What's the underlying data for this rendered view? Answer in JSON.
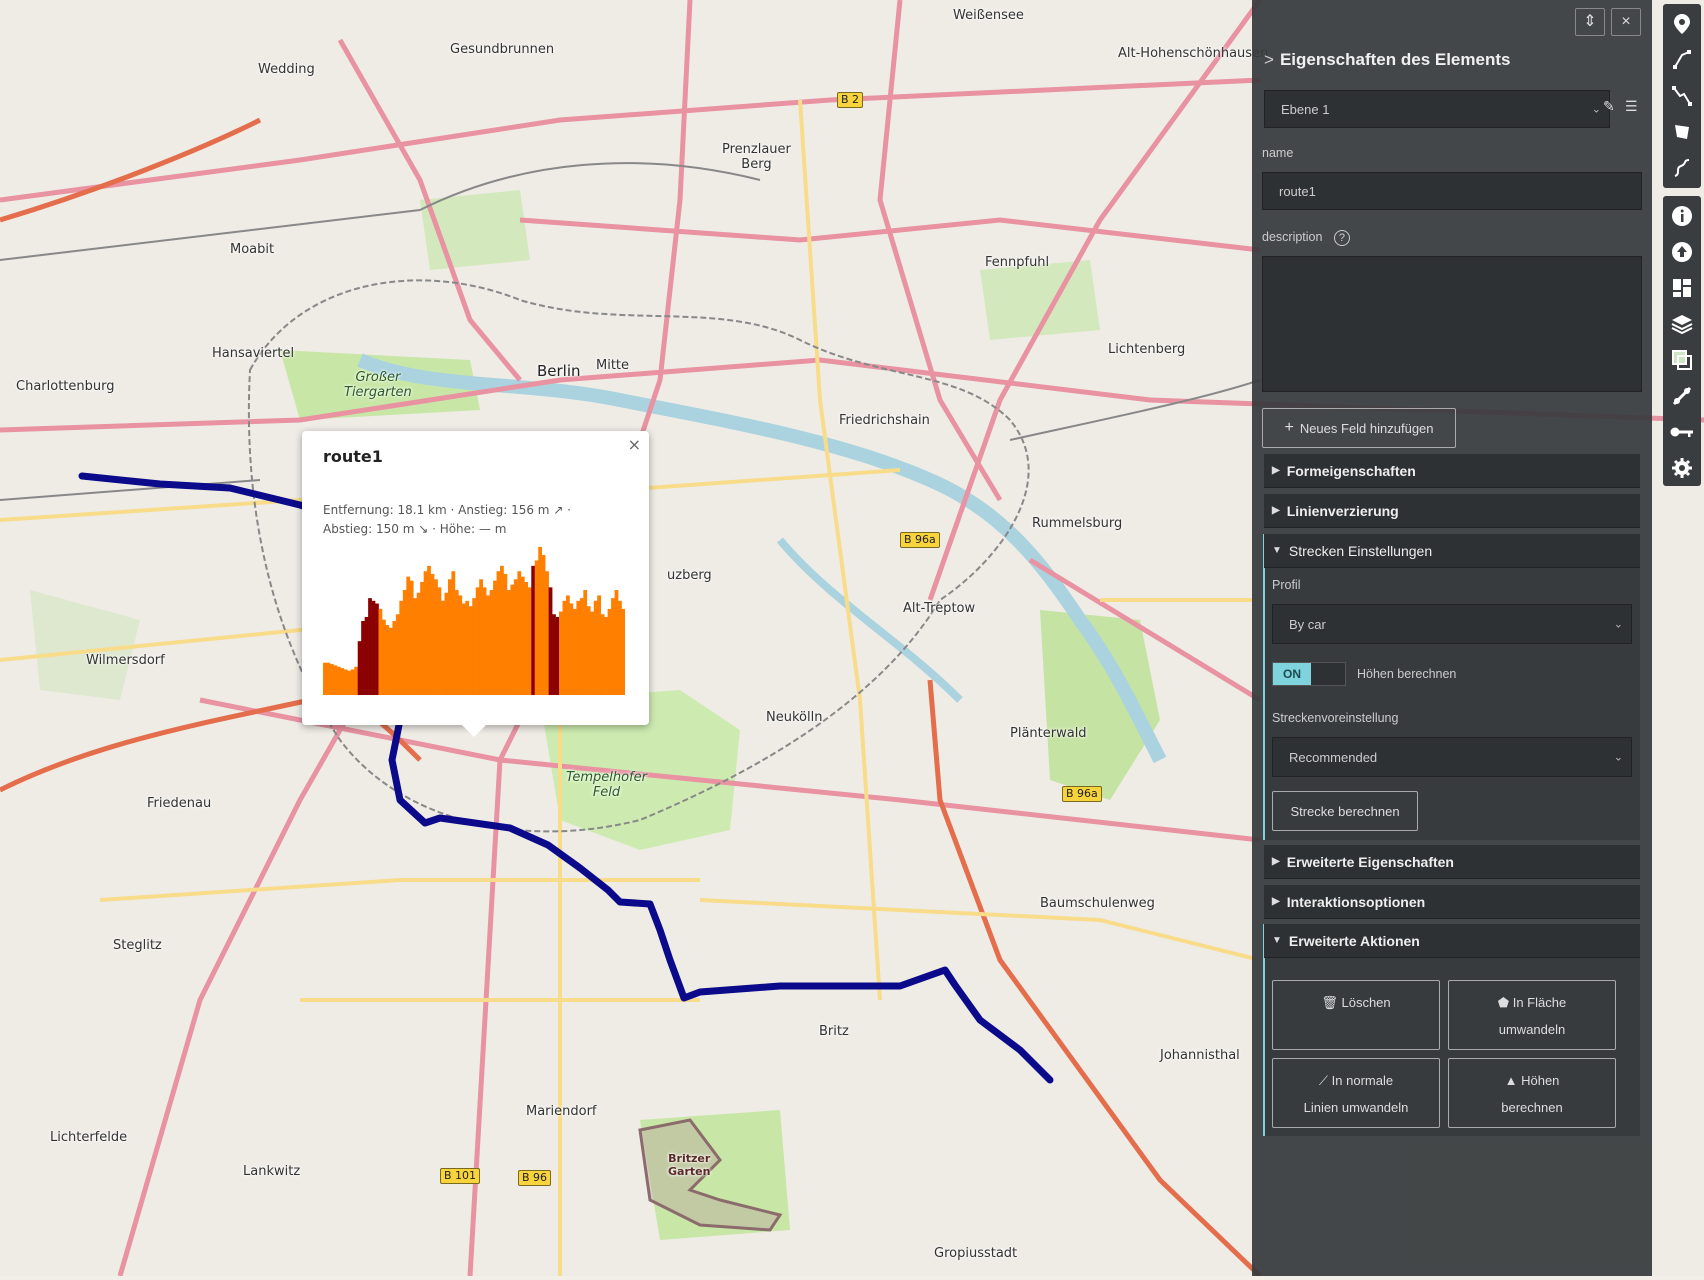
{
  "map": {
    "labels": {
      "weissensee": "Weißensee",
      "gesundbrunnen": "Gesundbrunnen",
      "wedding": "Wedding",
      "prenzlauer_berg": "Prenzlauer\nBerg",
      "moabit": "Moabit",
      "hansaviertel": "Hansaviertel",
      "charlottenburg": "Charlottenburg",
      "berlin": "Berlin",
      "mitte": "Mitte",
      "friedrichshain": "Friedrichshain",
      "lichtenberg": "Lichtenberg",
      "fennpfuhl": "Fennpfuhl",
      "rummelsburg": "Rummelsburg",
      "alt_treptow": "Alt-Treptow",
      "neukoelln": "Neukölln",
      "plaenterwald": "Plänterwald",
      "wilmersdorf": "Wilmersdorf",
      "friedenau": "Friedenau",
      "steglitz": "Steglitz",
      "tempelhofer_feld": "Tempelhofer\nFeld",
      "britz": "Britz",
      "baumschulenweg": "Baumschulenweg",
      "johannisthal": "Johannisthal",
      "mariendorf": "Mariendorf",
      "lichterfelde": "Lichterfelde",
      "lankwitz": "Lankwitz",
      "britzer_garten": "Britzer\nGarten",
      "gropiusstadt": "Gropiusstadt",
      "alt_hohenschoenhausen": "Alt-Hohenschönhausen",
      "grosser_tiergarten": "Großer\nTiergarten",
      "kreuzberg": "uzberg"
    },
    "shields": {
      "b2": "B 2",
      "b96a_1": "B 96a",
      "b96a_2": "B 96a",
      "b101": "B 101",
      "b96": "B 96"
    },
    "route_color": "#0a0a8a"
  },
  "popup": {
    "title": "route1",
    "close": "×",
    "stats": "Entfernung: 18.1 km · Anstieg: 156 m ↗ · Abstieg: 150 m ↘ · Höhe: — m",
    "elevation_profile": {
      "color_main": "#ff7f00",
      "color_steep": "#8b0000",
      "values": [
        24,
        24,
        23,
        22,
        21,
        20,
        19,
        18,
        19,
        21,
        40,
        55,
        58,
        72,
        70,
        68,
        64,
        56,
        52,
        50,
        55,
        60,
        70,
        78,
        88,
        85,
        72,
        76,
        84,
        92,
        96,
        90,
        86,
        80,
        70,
        76,
        86,
        92,
        78,
        74,
        68,
        70,
        66,
        72,
        80,
        86,
        80,
        74,
        78,
        85,
        92,
        96,
        90,
        78,
        82,
        86,
        92,
        88,
        84,
        80,
        96,
        100,
        110,
        104,
        92,
        80,
        60,
        58,
        62,
        70,
        74,
        68,
        64,
        70,
        72,
        78,
        66,
        62,
        70,
        74,
        60,
        58,
        64,
        72,
        78,
        70,
        64
      ]
    }
  },
  "panel": {
    "collapse_btn": "⇕",
    "close_btn": "×",
    "title": "Eigenschaften des Elements",
    "layer_select": "Ebene 1",
    "name_label": "name",
    "name_value": "route1",
    "description_label": "description",
    "add_field": "Neues Feld hinzufügen",
    "sections": {
      "shape": "Formeigenschaften",
      "line_decoration": "Linienverzierung",
      "route_settings": "Strecken Einstellungen",
      "advanced_props": "Erweiterte Eigenschaften",
      "interaction": "Interaktionsoptionen",
      "advanced_actions": "Erweiterte Aktionen"
    },
    "profile_label": "Profil",
    "profile_value": "By car",
    "toggle_on": "ON",
    "toggle_label": "Höhen berechnen",
    "preset_label": "Streckenvoreinstellung",
    "preset_value": "Recommended",
    "compute_route": "Strecke berechnen",
    "actions": {
      "delete": "Löschen",
      "to_polygon_1": "In Fläche",
      "to_polygon_2": "umwandeln",
      "to_line_1": "In normale",
      "to_line_2": "Linien umwandeln",
      "elev_1": "Höhen",
      "elev_2": "berechnen"
    }
  },
  "toolbar": {
    "icons": [
      "marker-icon",
      "line-icon",
      "route-icon",
      "polygon-icon",
      "freehand-icon",
      "info-icon",
      "upload-icon",
      "dashboard-icon",
      "layers-icon",
      "background-layer-icon",
      "tools-icon",
      "key-icon",
      "settings-icon"
    ]
  }
}
